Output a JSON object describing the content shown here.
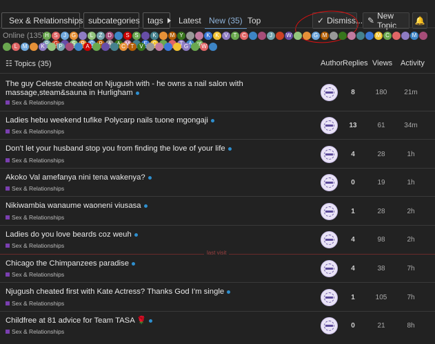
{
  "toolbar": {
    "category_label": "Sex & Relationships",
    "subcategories_label": "subcategories",
    "tags_label": "tags",
    "latest": "Latest",
    "new": "New (35)",
    "top": "Top",
    "dismiss": "Dismiss...",
    "new_topic": "New Topic"
  },
  "online": {
    "label": "Online (135)",
    "letters1": [
      "H",
      "S",
      "J",
      "G",
      "",
      "L",
      "Z",
      "D",
      "",
      "S",
      "S",
      "",
      "K",
      "",
      "M",
      "Y",
      "",
      "",
      "K",
      "K",
      "V",
      "T",
      "C",
      "",
      "",
      "J",
      "",
      "W",
      "",
      "",
      "G",
      "M",
      "",
      "",
      "",
      "",
      "",
      "M",
      "C",
      "",
      "",
      "M",
      "",
      "P",
      "G",
      "",
      "S",
      "P",
      "C",
      "P",
      "A",
      "A",
      "M",
      "",
      "E",
      "C",
      "",
      "",
      "T",
      "A",
      "gt"
    ],
    "colors1": [
      "#6aa84f",
      "#e06666",
      "#6fa8dc",
      "#e69138",
      "#8e7cc3",
      "#93c47d",
      "#76a5af",
      "#a64d79",
      "#3d85c6",
      "#cc0000",
      "#6aa84f",
      "#674ea7",
      "#45818e",
      "#e69138",
      "#b45f06",
      "#38761d",
      "#999999",
      "#c27ba0",
      "#3c78d8",
      "#f1c232",
      "#8e7cc3",
      "#6aa84f",
      "#e06666",
      "#3d85c6",
      "#a64d79",
      "#76a5af",
      "#cc4125",
      "#674ea7",
      "#93c47d",
      "#e69138",
      "#6fa8dc",
      "#b45f06",
      "#999999",
      "#38761d",
      "#c27ba0",
      "#45818e",
      "#3c78d8",
      "#f1c232",
      "#6aa84f",
      "#e06666",
      "#8e7cc3",
      "#3d85c6",
      "#a64d79",
      "#76a5af",
      "#cc4125",
      "#674ea7",
      "#93c47d",
      "#e69138",
      "#6fa8dc",
      "#b45f06",
      "#999999",
      "#38761d",
      "#c27ba0",
      "#45818e",
      "#3c78d8",
      "#f1c232",
      "#6aa84f",
      "#e06666",
      "#8e7cc3",
      "#3d85c6"
    ],
    "letters2": [
      "",
      "L",
      "M",
      "",
      "K",
      "",
      "P",
      "",
      "",
      "A",
      "",
      "",
      "",
      "C",
      "T",
      "V",
      "",
      "",
      "",
      "",
      "G",
      "",
      "W",
      ""
    ],
    "colors2": [
      "#6aa84f",
      "#e06666",
      "#6fa8dc",
      "#e69138",
      "#8e7cc3",
      "#93c47d",
      "#76a5af",
      "#a64d79",
      "#3d85c6",
      "#cc0000",
      "#6aa84f",
      "#674ea7",
      "#45818e",
      "#e69138",
      "#b45f06",
      "#38761d",
      "#999999",
      "#c27ba0",
      "#3c78d8",
      "#f1c232",
      "#8e7cc3",
      "#6aa84f",
      "#e06666",
      "#3d85c6"
    ]
  },
  "list": {
    "topics_label": "Topics (35)",
    "col_author": "Author",
    "col_replies": "Replies",
    "col_views": "Views",
    "col_activity": "Activity",
    "last_visit": "last visit"
  },
  "topics": [
    {
      "title": "The guy Celeste cheated on Njugush with - he owns a nail salon with massage,steam&sauna in Hurligham",
      "category": "Sex & Relationships",
      "replies": "8",
      "views": "180",
      "activity": "21m"
    },
    {
      "title": "Ladies hebu weekend tufike Polycarp nails tuone mgongaji",
      "category": "Sex & Relationships",
      "replies": "13",
      "views": "61",
      "activity": "34m"
    },
    {
      "title": "Don't let your husband stop you from finding the love of your life",
      "category": "Sex & Relationships",
      "replies": "4",
      "views": "28",
      "activity": "1h"
    },
    {
      "title": "Akoko Val amefanya nini tena wakenya?",
      "category": "Sex & Relationships",
      "replies": "0",
      "views": "19",
      "activity": "1h"
    },
    {
      "title": "Nikiwambia wanaume waoneni viusasa",
      "category": "Sex & Relationships",
      "replies": "1",
      "views": "28",
      "activity": "2h"
    },
    {
      "title": "Ladies do you love beards coz weuh",
      "category": "Sex & Relationships",
      "replies": "4",
      "views": "98",
      "activity": "2h"
    },
    {
      "title": "Chicago the Chimpanzees paradise",
      "category": "Sex & Relationships",
      "replies": "4",
      "views": "38",
      "activity": "7h"
    },
    {
      "title": "Njugush cheated first with Kate Actress? Thanks God I'm single",
      "category": "Sex & Relationships",
      "replies": "1",
      "views": "105",
      "activity": "7h"
    },
    {
      "title": "Childfree at 81 advice for Team TASA 🌹",
      "category": "Sex & Relationships",
      "replies": "0",
      "views": "21",
      "activity": "8h"
    }
  ],
  "colors": {
    "accent": "#5f8dbd",
    "category": "#7a3fb0",
    "unread_dot": "#2e8fcf",
    "annotation": "#d11111"
  }
}
